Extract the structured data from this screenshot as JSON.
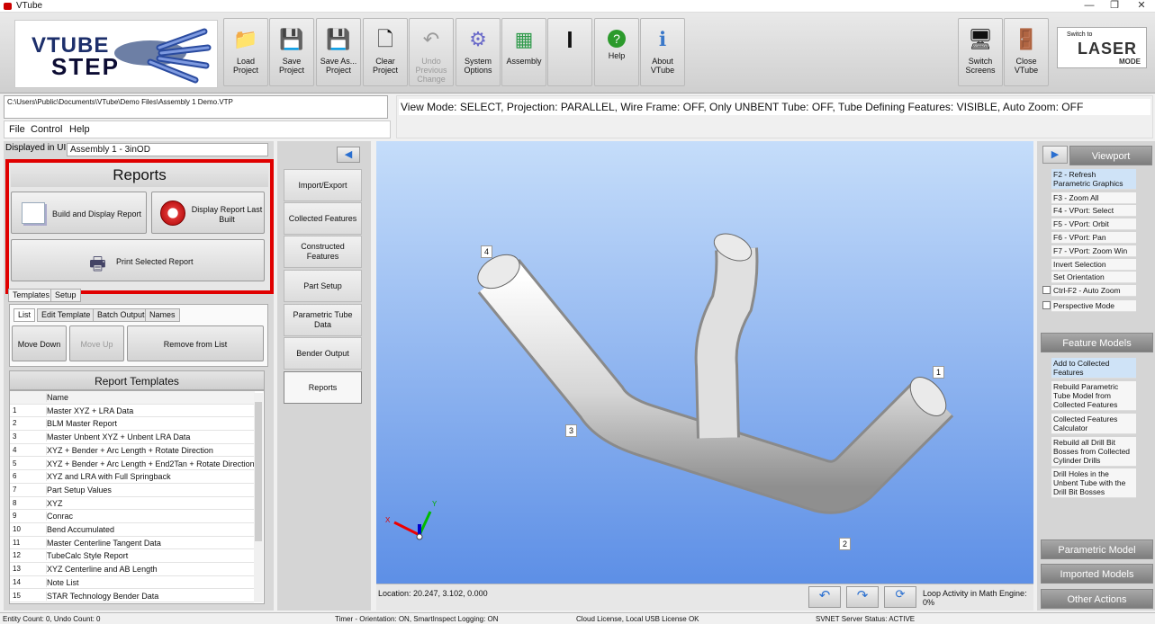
{
  "window": {
    "title": "VTube",
    "controls": [
      "—",
      "❐",
      "✕"
    ]
  },
  "logo": {
    "line1": "VTUBE",
    "line2": "STEP"
  },
  "toolbar": [
    {
      "label": "Load\nProject",
      "icon": "folder-icon",
      "enabled": true
    },
    {
      "label": "Save\nProject",
      "icon": "save-icon",
      "enabled": true
    },
    {
      "label": "Save As...\nProject",
      "icon": "save-as-icon",
      "enabled": true
    },
    {
      "label": "Clear\nProject",
      "icon": "clear-icon",
      "enabled": true
    },
    {
      "label": "Undo\nPrevious\nChange",
      "icon": "undo-icon",
      "enabled": false
    },
    {
      "label": "System\nOptions",
      "icon": "gear-icon",
      "enabled": true
    },
    {
      "label": "Assembly",
      "icon": "cubes-icon",
      "enabled": true
    },
    {
      "label": "",
      "icon": "text-cursor-icon",
      "enabled": true
    },
    {
      "label": "Help",
      "icon": "help-icon",
      "enabled": true
    },
    {
      "label": "About\nVTube",
      "icon": "info-icon",
      "enabled": true
    }
  ],
  "toolbar_right": [
    {
      "label": "Switch\nScreens",
      "icon": "monitor-icon"
    },
    {
      "label": "Close\nVTube",
      "icon": "door-icon"
    }
  ],
  "laser_badge": {
    "top": "Switch to",
    "main": "LASER",
    "bottom": "MODE"
  },
  "path": "C:\\Users\\Public\\Documents\\VTube\\Demo Files\\Assembly 1 Demo.VTP",
  "menus": [
    "File",
    "Control",
    "Help"
  ],
  "view_mode": "View Mode: SELECT, Projection: PARALLEL, Wire Frame: OFF, Only UNBENT Tube: OFF, Tube Defining Features: VISIBLE, Auto Zoom: OFF",
  "displayed": {
    "label": "Displayed in UI:",
    "value": "Assembly 1 - 3inOD"
  },
  "reports": {
    "title": "Reports",
    "build": "Build and Display Report",
    "display_last": "Display Report Last\nBuilt",
    "print": "Print Selected Report"
  },
  "main_tabs": [
    "Templates",
    "Setup"
  ],
  "sub_tabs": [
    "List",
    "Edit Template",
    "Batch Output",
    "Names"
  ],
  "list_buttons": {
    "move_down": "Move Down",
    "move_up": "Move Up",
    "remove": "Remove from List"
  },
  "templates": {
    "title": "Report Templates",
    "header": "Name",
    "rows": [
      {
        "n": "1",
        "name": "Master XYZ + LRA Data"
      },
      {
        "n": "2",
        "name": "BLM Master Report"
      },
      {
        "n": "3",
        "name": "Master Unbent XYZ + Unbent LRA Data"
      },
      {
        "n": "4",
        "name": "XYZ + Bender + Arc Length + Rotate Direction"
      },
      {
        "n": "5",
        "name": "XYZ + Bender + Arc Length + End2Tan + Rotate Direction"
      },
      {
        "n": "6",
        "name": "XYZ and LRA with Full Springback"
      },
      {
        "n": "7",
        "name": "Part Setup Values"
      },
      {
        "n": "8",
        "name": "XYZ"
      },
      {
        "n": "9",
        "name": "Conrac"
      },
      {
        "n": "10",
        "name": "Bend Accumulated"
      },
      {
        "n": "11",
        "name": "Master Centerline Tangent Data"
      },
      {
        "n": "12",
        "name": "TubeCalc Style Report"
      },
      {
        "n": "13",
        "name": "XYZ Centerline and AB Length"
      },
      {
        "n": "14",
        "name": "Note List"
      },
      {
        "n": "15",
        "name": "STAR Technology Bender Data"
      }
    ]
  },
  "nav": [
    "Import/Export",
    "Collected Features",
    "Constructed\nFeatures",
    "Part Setup",
    "Parametric Tube\nData",
    "Bender Output",
    "Reports"
  ],
  "viewport": {
    "location": "Location: 20.247, 3.102, 0.000",
    "loop": "Loop Activity in Math Engine: 0%",
    "labels": [
      "1",
      "2",
      "3",
      "4"
    ],
    "axes": {
      "x": "X",
      "y": "Y"
    }
  },
  "right": {
    "viewport_hdr": "Viewport",
    "viewport_items": [
      "F2 - Refresh\nParametric Graphics",
      "F3 - Zoom All",
      "F4 - VPort: Select",
      "F5 - VPort: Orbit",
      "F6 - VPort: Pan",
      "F7 - VPort: Zoom Win",
      "Invert Selection",
      "Set Orientation",
      "Ctrl-F2 - Auto Zoom",
      "Perspective Mode"
    ],
    "feature_hdr": "Feature Models",
    "feature_items": [
      "Add to Collected\nFeatures",
      "Rebuild Parametric\nTube Model from\nCollected Features",
      "Collected Features\nCalculator",
      "Rebuild all Drill Bit\nBosses from Collected\nCylinder Drills",
      "Drill Holes in the\nUnbent Tube with the\nDrill Bit Bosses"
    ],
    "param_hdr": "Parametric Model",
    "imported_hdr": "Imported Models",
    "other_hdr": "Other Actions"
  },
  "status": {
    "entity": "Entity Count: 0, Undo Count: 0",
    "timer": "Timer - Orientation: ON, SmartInspect Logging: ON",
    "license": "Cloud License, Local USB License OK",
    "svnet": "SVNET Server Status: ACTIVE"
  }
}
